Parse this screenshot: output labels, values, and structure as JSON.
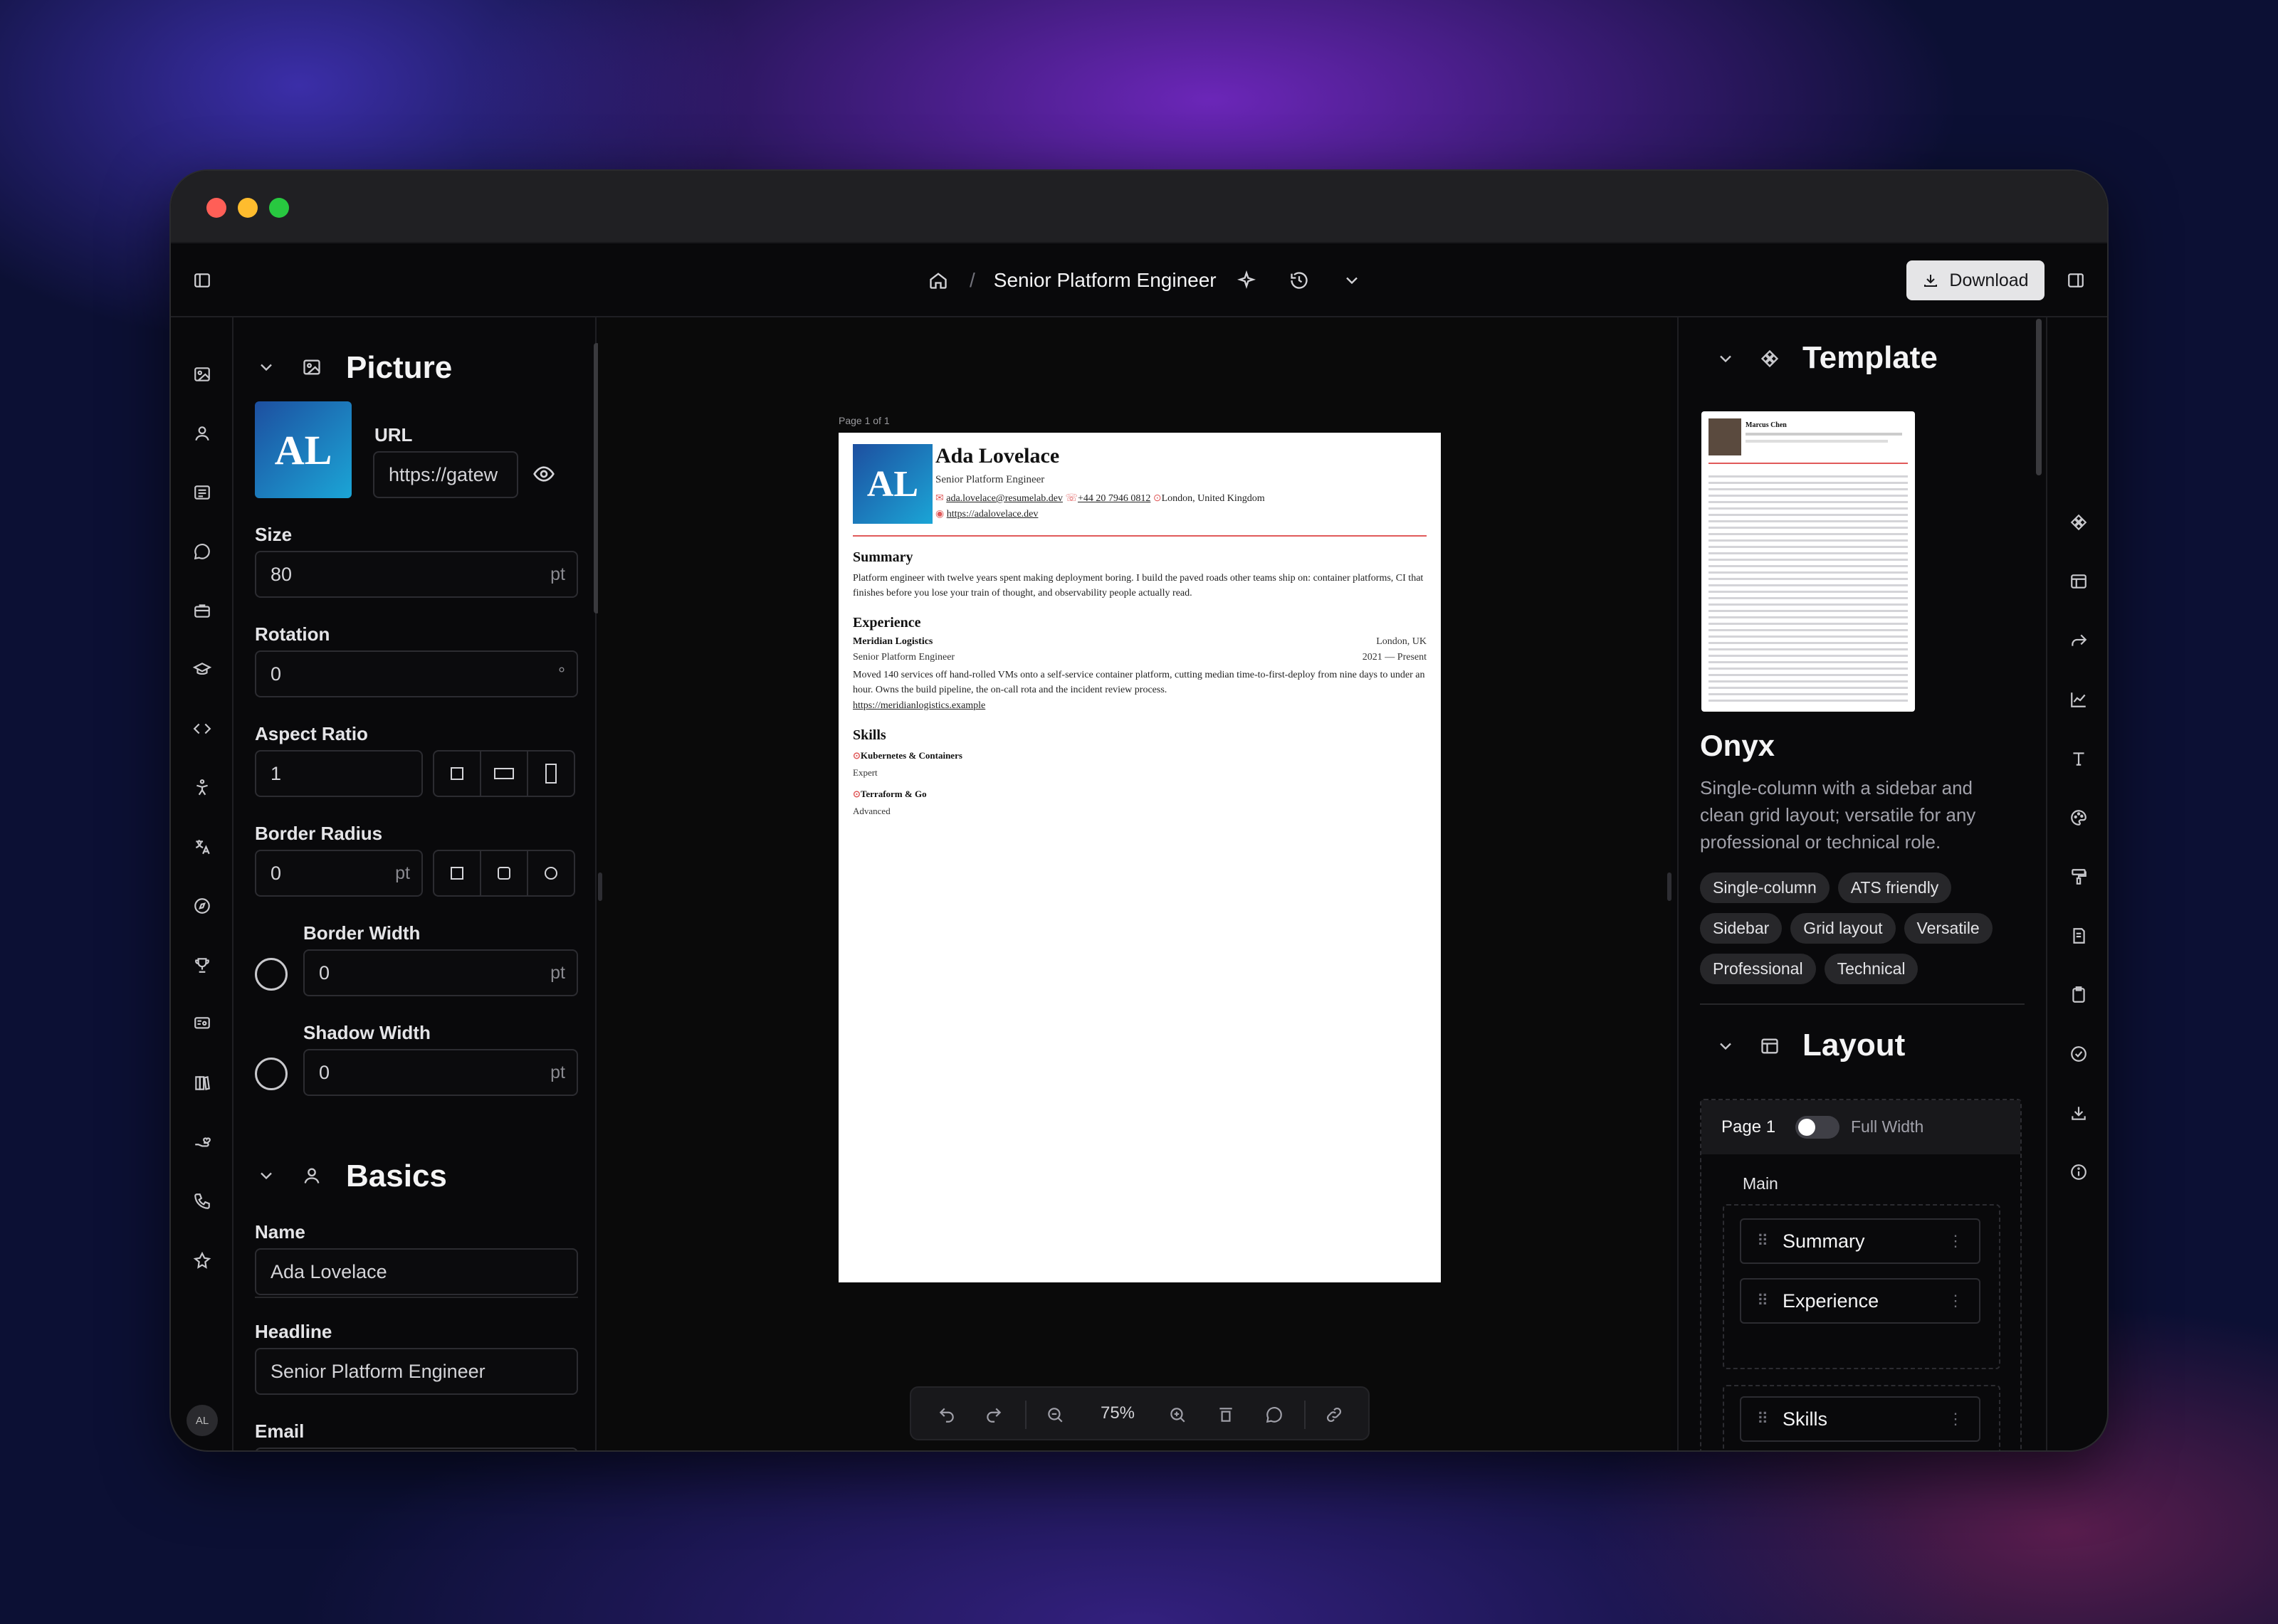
{
  "header": {
    "title": "Senior Platform Engineer",
    "separator": "/",
    "download_label": "Download"
  },
  "picture": {
    "title": "Picture",
    "avatar_text": "AL",
    "url_label": "URL",
    "url_value": "https://gatew",
    "size_label": "Size",
    "size_value": "80",
    "size_unit": "pt",
    "rotation_label": "Rotation",
    "rotation_value": "0",
    "rotation_unit": "°",
    "aspect_label": "Aspect Ratio",
    "aspect_value": "1",
    "radius_label": "Border Radius",
    "radius_value": "0",
    "radius_unit": "pt",
    "bwidth_label": "Border Width",
    "bwidth_value": "0",
    "bwidth_unit": "pt",
    "shadow_label": "Shadow Width",
    "shadow_value": "0",
    "shadow_unit": "pt"
  },
  "basics": {
    "title": "Basics",
    "name_label": "Name",
    "name_value": "Ada Lovelace",
    "headline_label": "Headline",
    "headline_value": "Senior Platform Engineer",
    "email_label": "Email"
  },
  "resume": {
    "page_label": "Page 1 of 1",
    "avatar_text": "AL",
    "name": "Ada Lovelace",
    "headline": "Senior Platform Engineer",
    "email": "ada.lovelace@resumelab.dev",
    "phone": "+44 20 7946 0812",
    "location": "London, United Kingdom",
    "website": "https://adalovelace.dev",
    "summary_title": "Summary",
    "summary_text": "Platform engineer with twelve years spent making deployment boring. I build the paved roads other teams ship on: container platforms, CI that finishes before you lose your train of thought, and observability people actually read.",
    "exp_title": "Experience",
    "exp_company": "Meridian Logistics",
    "exp_location": "London, UK",
    "exp_role": "Senior Platform Engineer",
    "exp_dates": "2021 — Present",
    "exp_desc": "Moved 140 services off hand-rolled VMs onto a self-service container platform, cutting median time-to-first-deploy from nine days to under an hour. Owns the build pipeline, the on-call rota and the incident review process.",
    "exp_link": "https://meridianlogistics.example",
    "skills_title": "Skills",
    "skill1": "Kubernetes & Containers",
    "skill1_level": "Expert",
    "skill2": "Terraform & Go",
    "skill2_level": "Advanced"
  },
  "zoom": "75%",
  "template": {
    "title": "Template",
    "name": "Onyx",
    "description": "Single-column with a sidebar and clean grid layout; versatile for any professional or technical role.",
    "tags": [
      "Single-column",
      "ATS friendly",
      "Sidebar",
      "Grid layout",
      "Versatile",
      "Professional",
      "Technical"
    ],
    "thumb_name": "Marcus Chen"
  },
  "layout": {
    "title": "Layout",
    "page_label": "Page 1",
    "full_width_label": "Full Width",
    "main_label": "Main",
    "items": [
      "Summary",
      "Experience",
      "Skills"
    ]
  },
  "colors": {
    "accent": "#e05a5a",
    "avatar_start": "#1d4fa0",
    "avatar_end": "#1ba5d6"
  }
}
